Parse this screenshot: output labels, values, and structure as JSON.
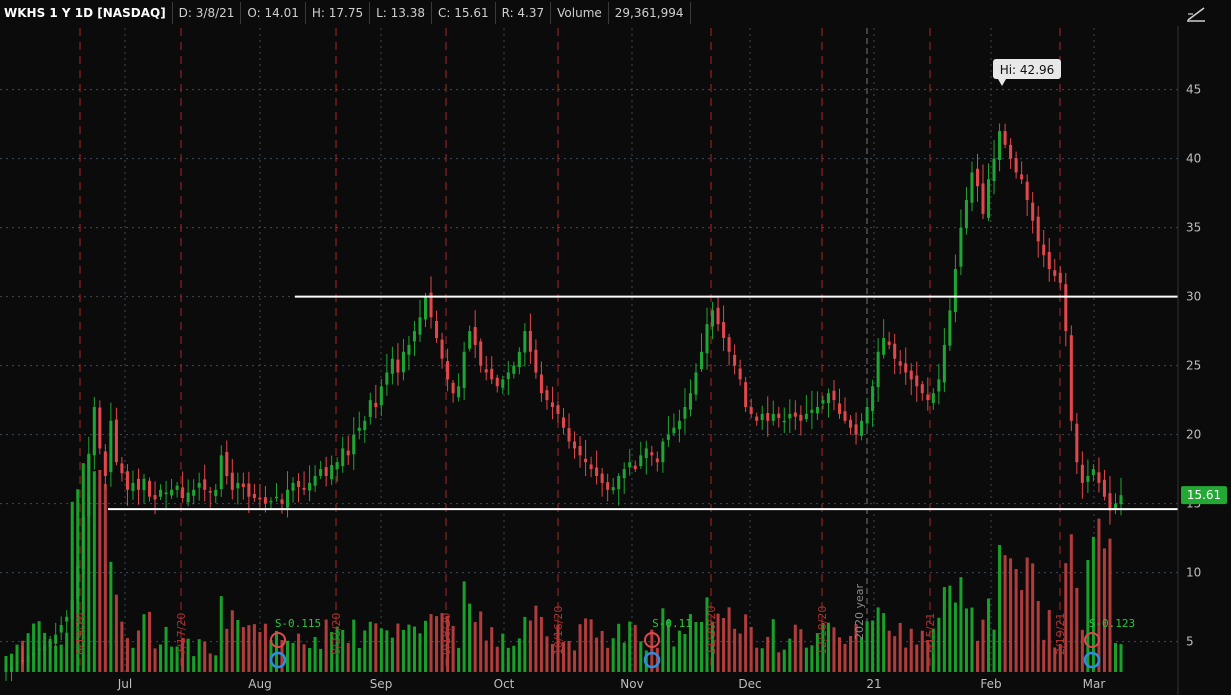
{
  "header": {
    "symbol": "WKHS 1 Y 1D [NASDAQ]",
    "date": "D: 3/8/21",
    "open": "O: 14.01",
    "high": "H: 17.75",
    "low": "L: 13.38",
    "close": "C: 15.61",
    "range": "R: 4.37",
    "volume_label": "Volume",
    "volume_value": "29,361,994"
  },
  "toolbar": {
    "icon": "drawing-tool-icon"
  },
  "colors": {
    "up": "#1fa534",
    "down": "#e0484c",
    "vol_up": "#19a02a",
    "vol_down": "#b03c3c",
    "last_price_bg": "#22a833",
    "background": "#0b0b0b",
    "grid": "#3c4a5a"
  },
  "chart_data": {
    "type": "candlestick",
    "title": "WKHS 1 Y 1D [NASDAQ]",
    "y_ticks": [
      "45",
      "40",
      "35",
      "30",
      "25",
      "20",
      "15",
      "10",
      "5"
    ],
    "x_ticks": [
      "Jul",
      "Aug",
      "Sep",
      "Oct",
      "Nov",
      "Dec",
      "21",
      "Feb",
      "Mar"
    ],
    "ylim": [
      2,
      47
    ],
    "last_price": "15.61",
    "high_label": "Hi: 42.96",
    "horizontal_lines": [
      30,
      14.6
    ],
    "grid": true,
    "divider_label": "2020 year",
    "event_labels": [
      "6/19/20",
      "7/17/20",
      "8/21/20",
      "9/18/20",
      "10/16/20",
      "11/20/20",
      "12/18/20",
      "1/15/21",
      "2/19/21"
    ],
    "earnings_labels": [
      "S-0.115",
      "S-0.11",
      "S-0.123"
    ],
    "price_path": [
      3.0,
      3.2,
      3.5,
      3.6,
      4.0,
      4.2,
      4.5,
      4.7,
      5.0,
      5.5,
      6.2,
      6.8,
      8.0,
      10.5,
      14.0,
      18.5,
      22.0,
      19.0,
      17.0,
      21.0,
      18.0,
      17.2,
      16.0,
      16.5,
      16.0,
      16.8,
      15.5,
      15.3,
      16.0,
      15.8,
      16.0,
      16.3,
      15.4,
      15.8,
      16.0,
      16.5,
      16.0,
      15.8,
      16.0,
      18.5,
      17.0,
      16.0,
      16.5,
      16.2,
      15.5,
      15.4,
      15.3,
      15.0,
      15.2,
      15.5,
      15.0,
      16.0,
      16.5,
      16.2,
      16.0,
      16.5,
      17.0,
      17.5,
      17.0,
      17.8,
      18.0,
      19.0,
      18.5,
      20.0,
      20.5,
      21.0,
      22.5,
      22.0,
      23.5,
      24.5,
      25.5,
      24.5,
      26.0,
      26.5,
      27.5,
      28.5,
      30.0,
      28.5,
      27.0,
      25.5,
      24.0,
      23.0,
      23.5,
      26.0,
      27.5,
      26.5,
      25.0,
      24.5,
      24.0,
      23.5,
      24.0,
      24.5,
      25.0,
      26.0,
      27.5,
      26.0,
      24.5,
      23.0,
      22.5,
      22.0,
      21.5,
      20.5,
      19.5,
      19.0,
      18.5,
      18.0,
      17.5,
      17.0,
      16.5,
      16.0,
      16.2,
      17.0,
      17.5,
      18.0,
      17.5,
      18.5,
      19.0,
      18.5,
      18.0,
      19.5,
      20.0,
      20.5,
      21.0,
      22.0,
      23.0,
      24.5,
      26.0,
      28.0,
      29.0,
      28.0,
      27.0,
      26.0,
      25.0,
      24.0,
      22.0,
      21.5,
      21.0,
      21.5,
      21.0,
      21.5,
      21.2,
      21.0,
      21.5,
      21.3,
      21.0,
      21.5,
      21.8,
      22.0,
      22.5,
      23.0,
      22.5,
      21.5,
      21.0,
      20.5,
      20.0,
      21.0,
      22.0,
      23.5,
      26.0,
      27.0,
      26.5,
      25.5,
      25.0,
      24.5,
      24.0,
      23.5,
      23.0,
      22.5,
      23.0,
      24.0,
      26.5,
      29.0,
      32.0,
      35.0,
      37.0,
      39.0,
      38.0,
      36.0,
      38.5,
      40.0,
      42.0,
      41.0,
      40.0,
      39.0,
      38.5,
      37.0,
      35.5,
      34.0,
      33.0,
      32.0,
      31.5,
      31.0,
      27.5,
      21.0,
      18.0,
      16.5,
      17.0,
      17.5,
      16.5,
      15.5,
      14.5,
      15.0,
      15.61
    ]
  }
}
